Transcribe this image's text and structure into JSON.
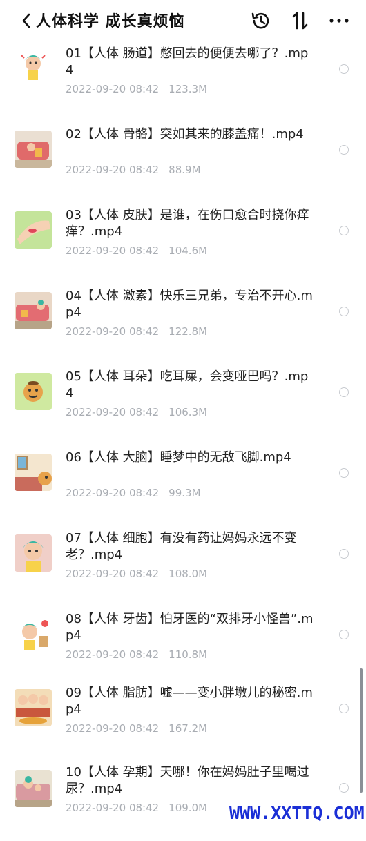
{
  "header": {
    "title": "人体科学 成长真烦恼",
    "icons": [
      "chevron-left-icon",
      "history-icon",
      "sort-icon",
      "more-icon"
    ]
  },
  "files": [
    {
      "name": "01【人体 肠道】憋回去的便便去哪了？.mp4",
      "date": "2022-09-20 08:42",
      "size": "123.3M"
    },
    {
      "name": "02【人体 骨骼】突如其来的膝盖痛！.mp4",
      "date": "2022-09-20 08:42",
      "size": "88.9M"
    },
    {
      "name": "03【人体 皮肤】是谁，在伤口愈合时挠你痒痒？.mp4",
      "date": "2022-09-20 08:42",
      "size": "104.6M"
    },
    {
      "name": "04【人体 激素】快乐三兄弟，专治不开心.mp4",
      "date": "2022-09-20 08:42",
      "size": "122.8M"
    },
    {
      "name": "05【人体 耳朵】吃耳屎，会变哑巴吗？.mp4",
      "date": "2022-09-20 08:42",
      "size": "106.3M"
    },
    {
      "name": "06【人体 大脑】睡梦中的无敌飞脚.mp4",
      "date": "2022-09-20 08:42",
      "size": "99.3M"
    },
    {
      "name": "07【人体 细胞】有没有药让妈妈永远不变老？.mp4",
      "date": "2022-09-20 08:42",
      "size": "108.0M"
    },
    {
      "name": "08【人体 牙齿】怕牙医的“双排牙小怪兽”.mp4",
      "date": "2022-09-20 08:42",
      "size": "110.8M"
    },
    {
      "name": "09【人体 脂肪】嘘——变小胖墩儿的秘密.mp4",
      "date": "2022-09-20 08:42",
      "size": "167.2M"
    },
    {
      "name": "10【人体 孕期】天哪！你在妈妈肚子里喝过尿？.mp4",
      "date": "2022-09-20 08:42",
      "size": "109.0M"
    }
  ],
  "watermark": "WWW.XXTTQ.COM",
  "colors": {
    "meta_text": "#a9adb3",
    "watermark": "#1b2fd6"
  }
}
